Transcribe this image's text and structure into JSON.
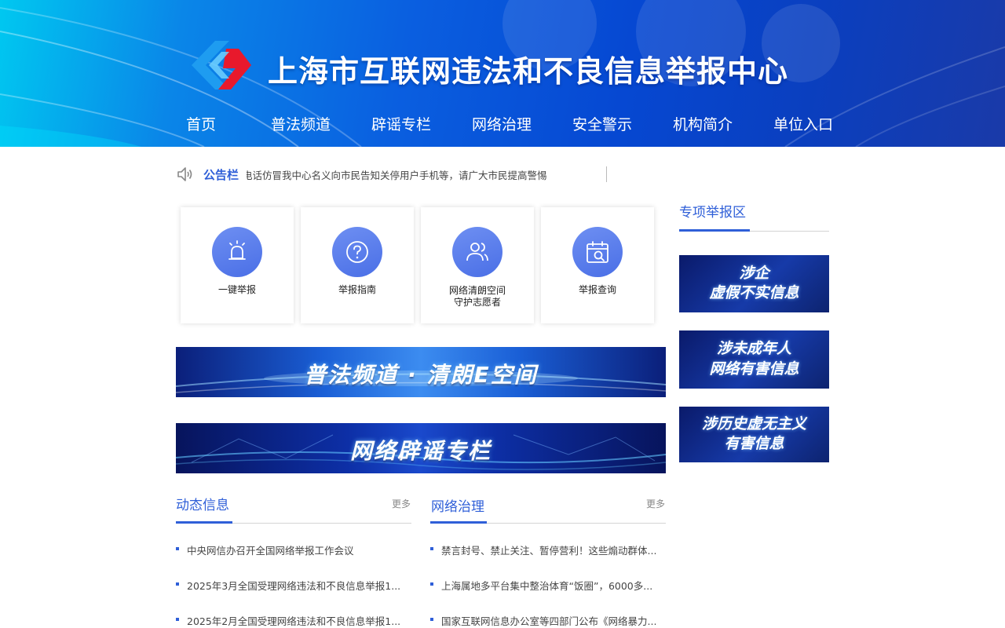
{
  "header": {
    "title": "上海市互联网违法和不良信息举报中心",
    "nav": [
      "首页",
      "普法频道",
      "辟谣专栏",
      "网络治理",
      "安全警示",
      "机构简介",
      "单位入口"
    ]
  },
  "notice": {
    "label": "公告栏",
    "text": "近期有不法分子冒用我中心名义进行电信诈骗，以疑似诈骗电话仿冒我中心名义向市民告知关停用户手机等，请广大市民提高警惕"
  },
  "quick": [
    {
      "icon": "alarm-icon",
      "label": "一键举报"
    },
    {
      "icon": "question-icon",
      "label": "举报指南"
    },
    {
      "icon": "users-icon",
      "label": "网络清朗空间\n守护志愿者"
    },
    {
      "icon": "calendar-search-icon",
      "label": "举报查询"
    }
  ],
  "banners": [
    "普法频道 · 清朗E空间",
    "网络辟谣专栏"
  ],
  "side": {
    "title": "专项举报区",
    "cards": [
      {
        "line1": "涉企",
        "line2": "虚假不实信息"
      },
      {
        "line1": "涉未成年人",
        "line2": "网络有害信息"
      },
      {
        "line1": "涉历史虚无主义",
        "line2": "有害信息"
      }
    ]
  },
  "news": {
    "left": {
      "title": "动态信息",
      "more": "更多",
      "items": [
        "中央网信办召开全国网络举报工作会议",
        "2025年3月全国受理网络违法和不良信息举报1...",
        "2025年2月全国受理网络违法和不良信息举报1..."
      ]
    },
    "right": {
      "title": "网络治理",
      "more": "更多",
      "items": [
        "禁言封号、禁止关注、暂停营利！这些煽动群体...",
        "上海属地多平台集中整治体育“饭圈”，6000多...",
        "国家互联网信息办公室等四部门公布《网络暴力..."
      ]
    }
  },
  "colors": {
    "accent": "#2f5fd8",
    "logo_red": "#e8192c",
    "logo_blue": "#1e9cf0"
  }
}
